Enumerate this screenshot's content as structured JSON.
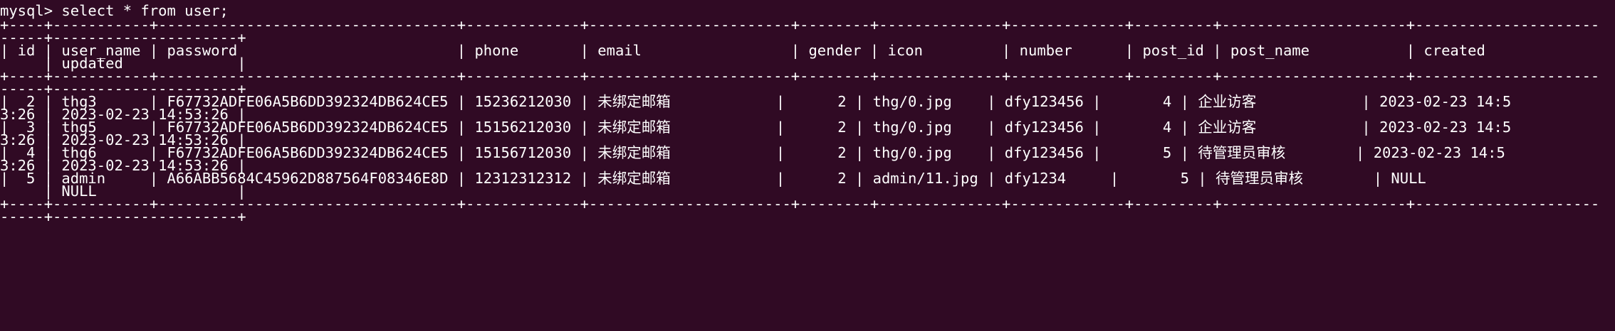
{
  "terminal": {
    "background": "#300a24",
    "foreground": "#ffffff",
    "lines": [
      "mysql> select * from user;",
      "+----+-----------+----------------------------------+-------------+-----------------------+--------+--------------+-------------+---------+---------------------+---------------------",
      "-----+---------------------+",
      "| id | user_name | password                         | phone       | email                 | gender | icon         | number      | post_id | post_name           | created             ",
      "     | updated             |",
      "+----+-----------+----------------------------------+-------------+-----------------------+--------+--------------+-------------+---------+---------------------+---------------------",
      "-----+---------------------+",
      "|  2 | thg3      | F67732ADFE06A5B6DD392324DB624CE5 | 15236212030 | 未绑定邮箱            |      2 | thg/0.jpg    | dfy123456 |       4 | 企业访客            | 2023-02-23 14:5",
      "3:26 | 2023-02-23 14:53:26 |",
      "|  3 | thg5      | F67732ADFE06A5B6DD392324DB624CE5 | 15156212030 | 未绑定邮箱            |      2 | thg/0.jpg    | dfy123456 |       4 | 企业访客            | 2023-02-23 14:5",
      "3:26 | 2023-02-23 14:53:26 |",
      "|  4 | thg6      | F67732ADFE06A5B6DD392324DB624CE5 | 15156712030 | 未绑定邮箱            |      2 | thg/0.jpg    | dfy123456 |       5 | 待管理员审核        | 2023-02-23 14:5",
      "3:26 | 2023-02-23 14:53:26 |",
      "|  5 | admin     | A66ABB5684C45962D887564F08346E8D | 12312312312 | 未绑定邮箱            |      2 | admin/11.jpg | dfy1234     |       5 | 待管理员审核        | NULL                ",
      "     | NULL                |",
      "+----+-----------+----------------------------------+-------------+-----------------------+--------+--------------+-------------+---------+---------------------+---------------------",
      "-----+---------------------+"
    ]
  }
}
